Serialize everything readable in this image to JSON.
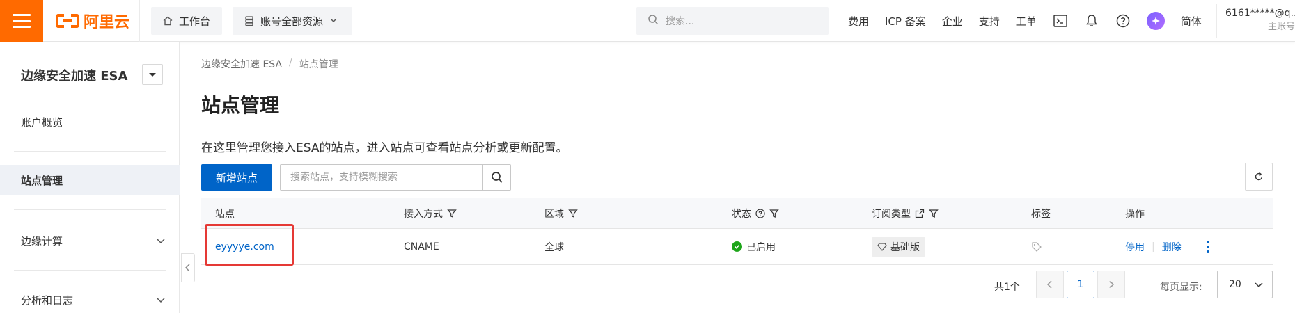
{
  "header": {
    "logo_text": "阿里云",
    "workbench": "工作台",
    "resources": "账号全部资源",
    "search_placeholder": "搜索...",
    "links": [
      "费用",
      "ICP 备案",
      "企业",
      "支持",
      "工单"
    ],
    "lang": "简体",
    "account_name": "6161*****@q...",
    "account_role": "主账号"
  },
  "sidebar": {
    "product": "边缘安全加速 ESA",
    "items": [
      {
        "label": "账户概览"
      },
      {
        "label": "站点管理"
      },
      {
        "label": "边缘计算"
      },
      {
        "label": "分析和日志"
      }
    ]
  },
  "main": {
    "breadcrumb": [
      "边缘安全加速 ESA",
      "站点管理"
    ],
    "breadcrumb_sep": "/",
    "title": "站点管理",
    "description": "在这里管理您接入ESA的站点，进入站点可查看站点分析或更新配置。",
    "add_button": "新增站点",
    "search_placeholder": "搜索站点，支持模糊搜索"
  },
  "table": {
    "columns": [
      "站点",
      "接入方式",
      "区域",
      "状态",
      "订阅类型",
      "标签",
      "操作"
    ],
    "rows": [
      {
        "site": "eyyyye.com",
        "access": "CNAME",
        "region": "全球",
        "status": "已启用",
        "plan": "基础版",
        "actions": [
          "停用",
          "删除"
        ]
      }
    ]
  },
  "pagination": {
    "total": "共1个",
    "current_page": "1",
    "per_page_label": "每页显示:",
    "per_page_value": "20"
  },
  "colors": {
    "brand": "#ff6a00",
    "primary": "#0064c8",
    "status_enabled": "#1ea51a",
    "highlight": "#e53935"
  }
}
